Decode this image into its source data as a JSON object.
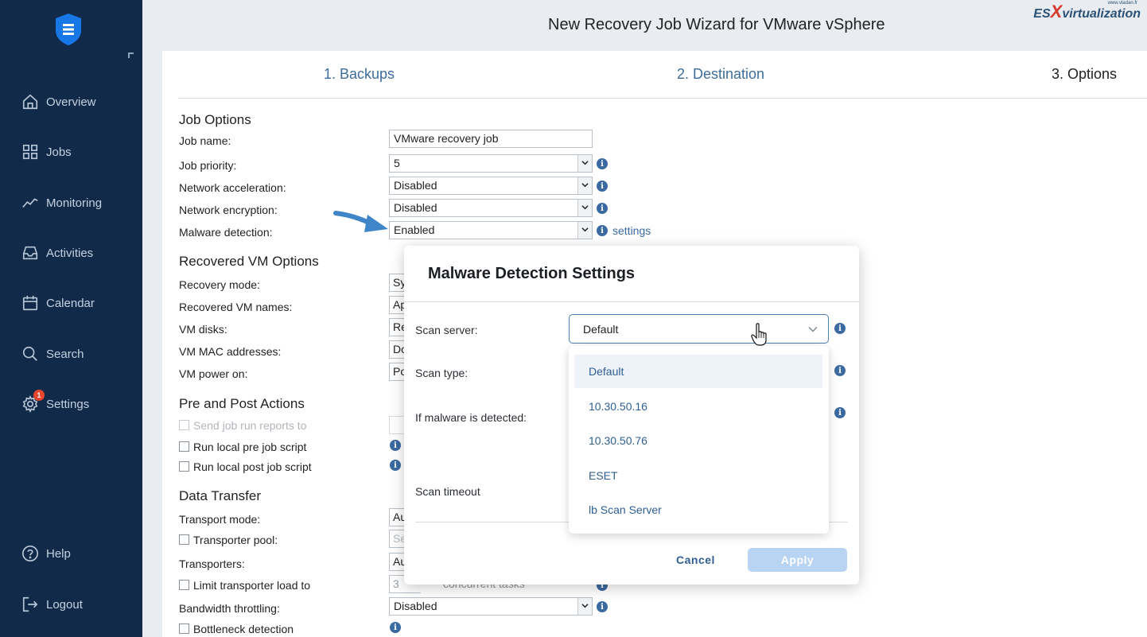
{
  "window": {
    "title": "New Recovery Job Wizard for VMware vSphere"
  },
  "watermark": {
    "prefix": "ES",
    "x": "X",
    "suffix": "virtualization",
    "url": "www.vladan.fr"
  },
  "sidebar": {
    "items": [
      {
        "label": "Overview",
        "icon": "home-icon"
      },
      {
        "label": "Jobs",
        "icon": "grid-icon"
      },
      {
        "label": "Monitoring",
        "icon": "chart-line-icon"
      },
      {
        "label": "Activities",
        "icon": "inbox-icon"
      },
      {
        "label": "Calendar",
        "icon": "calendar-icon"
      },
      {
        "label": "Search",
        "icon": "search-icon"
      },
      {
        "label": "Settings",
        "icon": "gear-icon",
        "badge": "1"
      },
      {
        "label": "Help",
        "icon": "help-icon"
      },
      {
        "label": "Logout",
        "icon": "logout-icon"
      }
    ]
  },
  "steps": [
    "1. Backups",
    "2. Destination",
    "3. Options"
  ],
  "job_options": {
    "heading": "Job Options",
    "job_name_label": "Job name:",
    "job_name_value": "VMware recovery job",
    "job_priority_label": "Job priority:",
    "job_priority_value": "5",
    "net_accel_label": "Network acceleration:",
    "net_accel_value": "Disabled",
    "net_enc_label": "Network encryption:",
    "net_enc_value": "Disabled",
    "malware_label": "Malware detection:",
    "malware_value": "Enabled",
    "settings_link": "settings"
  },
  "recovered_vm": {
    "heading": "Recovered VM Options",
    "rows": [
      {
        "label": "Recovery mode:",
        "frag": "Sy"
      },
      {
        "label": "Recovered VM names:",
        "frag": "Ap"
      },
      {
        "label": "VM disks:",
        "frag": "Re"
      },
      {
        "label": "VM MAC addresses:",
        "frag": "Do"
      },
      {
        "label": "VM power on:",
        "frag": "Po"
      }
    ]
  },
  "pre_post": {
    "heading": "Pre and Post Actions",
    "send_reports": "Send job run reports to",
    "pre_script": "Run local pre job script",
    "post_script": "Run local post job script"
  },
  "data_transfer": {
    "heading": "Data Transfer",
    "transport_mode_label": "Transport mode:",
    "transport_mode_frag": "Au",
    "transporter_pool": "Transporter pool:",
    "transporter_pool_frag": "Se",
    "transporters_label": "Transporters:",
    "transporters_frag": "Au",
    "limit_load": "Limit transporter load to",
    "limit_value": "3",
    "concurrent_tasks": "concurrent tasks",
    "bandwidth_label": "Bandwidth throttling:",
    "bandwidth_value": "Disabled",
    "bottleneck": "Bottleneck detection"
  },
  "modal": {
    "title": "Malware Detection Settings",
    "scan_server_label": "Scan server:",
    "scan_server_value": "Default",
    "scan_type_label": "Scan type:",
    "if_detected_label": "If malware is detected:",
    "scan_timeout_label": "Scan timeout",
    "cancel_label": "Cancel",
    "apply_label": "Apply",
    "options": [
      "Default",
      "10.30.50.16",
      "10.30.50.76",
      "ESET",
      "lb Scan Server"
    ]
  },
  "colors": {
    "sidebar_bg": "#112a4a",
    "accent": "#3a6aa0",
    "badge": "#e8452c",
    "apply_disabled": "#b9d4f2"
  }
}
